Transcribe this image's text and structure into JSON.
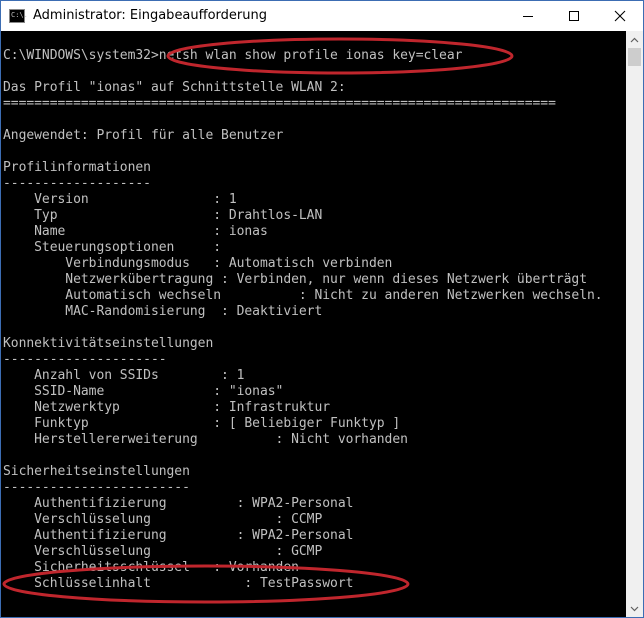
{
  "window": {
    "title": "Administrator: Eingabeaufforderung",
    "app_icon_text": "C:\\.",
    "annotation_color": "#c0262d"
  },
  "console": {
    "lines": [
      "C:\\WINDOWS\\system32>netsh wlan show profile ionas key=clear",
      "",
      "Das Profil \"ionas\" auf Schnittstelle WLAN 2:",
      "=======================================================================",
      "",
      "Angewendet: Profil für alle Benutzer",
      "",
      "Profilinformationen",
      "-------------------",
      "    Version                : 1",
      "    Typ                    : Drahtlos-LAN",
      "    Name                   : ionas",
      "    Steuerungsoptionen     :",
      "        Verbindungsmodus   : Automatisch verbinden",
      "        Netzwerkübertragung : Verbinden, nur wenn dieses Netzwerk überträgt",
      "        Automatisch wechseln          : Nicht zu anderen Netzwerken wechseln.",
      "        MAC-Randomisierung  : Deaktiviert",
      "",
      "Konnektivitätseinstellungen",
      "---------------------",
      "    Anzahl von SSIDs        : 1",
      "    SSID-Name              : \"ionas\"",
      "    Netzwerktyp            : Infrastruktur",
      "    Funktyp                : [ Beliebiger Funktyp ]",
      "    Herstellererweiterung          : Nicht vorhanden",
      "",
      "Sicherheitseinstellungen",
      "------------------------",
      "    Authentifizierung         : WPA2-Personal",
      "    Verschlüsselung                : CCMP",
      "    Authentifizierung         : WPA2-Personal",
      "    Verschlüsselung                : GCMP",
      "    Sicherheitsschlüssel   : Vorhanden",
      "    Schlüsselinhalt            : TestPasswort"
    ]
  }
}
